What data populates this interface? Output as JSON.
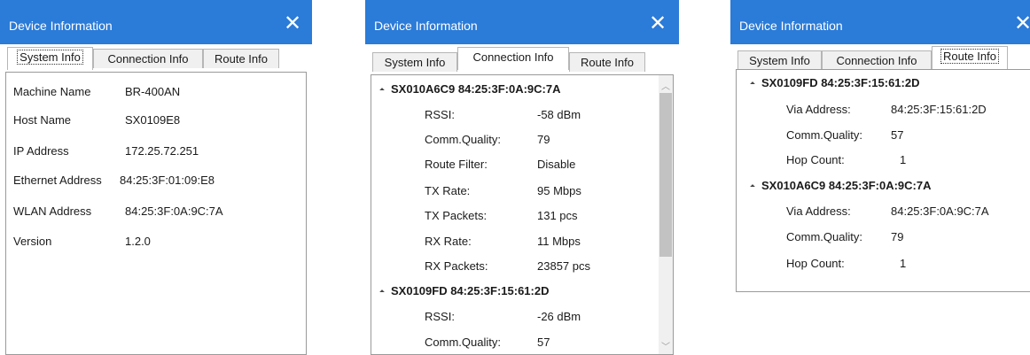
{
  "windows": [
    {
      "title": "Device Information",
      "close_glyph": "✕",
      "tabs": [
        "System Info",
        "Connection Info",
        "Route Info"
      ],
      "active_tab": "System Info",
      "system_info": [
        {
          "label": "Machine Name",
          "value": "BR-400AN"
        },
        {
          "label": "Host Name",
          "value": "SX0109E8"
        },
        {
          "label": "IP Address",
          "value": "172.25.72.251"
        },
        {
          "label": "Ethernet Address",
          "value": "84:25:3F:01:09:E8"
        },
        {
          "label": "WLAN Address",
          "value": "84:25:3F:0A:9C:7A"
        },
        {
          "label": "Version",
          "value": "1.2.0"
        }
      ]
    },
    {
      "title": "Device Information",
      "close_glyph": "✕",
      "tabs": [
        "System Info",
        "Connection Info",
        "Route Info"
      ],
      "active_tab": "Connection Info",
      "connections": [
        {
          "node": "SX010A6C9  84:25:3F:0A:9C:7A",
          "fields": [
            {
              "label": "RSSI:",
              "value": "-58 dBm"
            },
            {
              "label": "Comm.Quality:",
              "value": "79"
            },
            {
              "label": "Route Filter:",
              "value": "Disable"
            },
            {
              "label": "TX Rate:",
              "value": "95 Mbps"
            },
            {
              "label": "TX Packets:",
              "value": "131 pcs"
            },
            {
              "label": "RX Rate:",
              "value": "11 Mbps"
            },
            {
              "label": "RX Packets:",
              "value": "23857 pcs"
            }
          ]
        },
        {
          "node": "SX0109FD  84:25:3F:15:61:2D",
          "fields": [
            {
              "label": "RSSI:",
              "value": "-26 dBm"
            },
            {
              "label": "Comm.Quality:",
              "value": "57"
            }
          ]
        }
      ]
    },
    {
      "title": "Device Information",
      "close_glyph": "✕",
      "tabs": [
        "System Info",
        "Connection Info",
        "Route Info"
      ],
      "active_tab": "Route Info",
      "routes": [
        {
          "node": "SX0109FD  84:25:3F:15:61:2D",
          "fields": [
            {
              "label": "Via Address:",
              "value": "84:25:3F:15:61:2D"
            },
            {
              "label": "Comm.Quality:",
              "value": "57"
            },
            {
              "label": "Hop Count:",
              "value": "1"
            }
          ]
        },
        {
          "node": "SX010A6C9  84:25:3F:0A:9C:7A",
          "fields": [
            {
              "label": "Via Address:",
              "value": "84:25:3F:0A:9C:7A"
            },
            {
              "label": "Comm.Quality:",
              "value": "79"
            },
            {
              "label": "Hop Count:",
              "value": "1"
            }
          ]
        }
      ]
    }
  ],
  "colors": {
    "titlebar": "#2b7bd8",
    "border": "#9a9a9a"
  }
}
